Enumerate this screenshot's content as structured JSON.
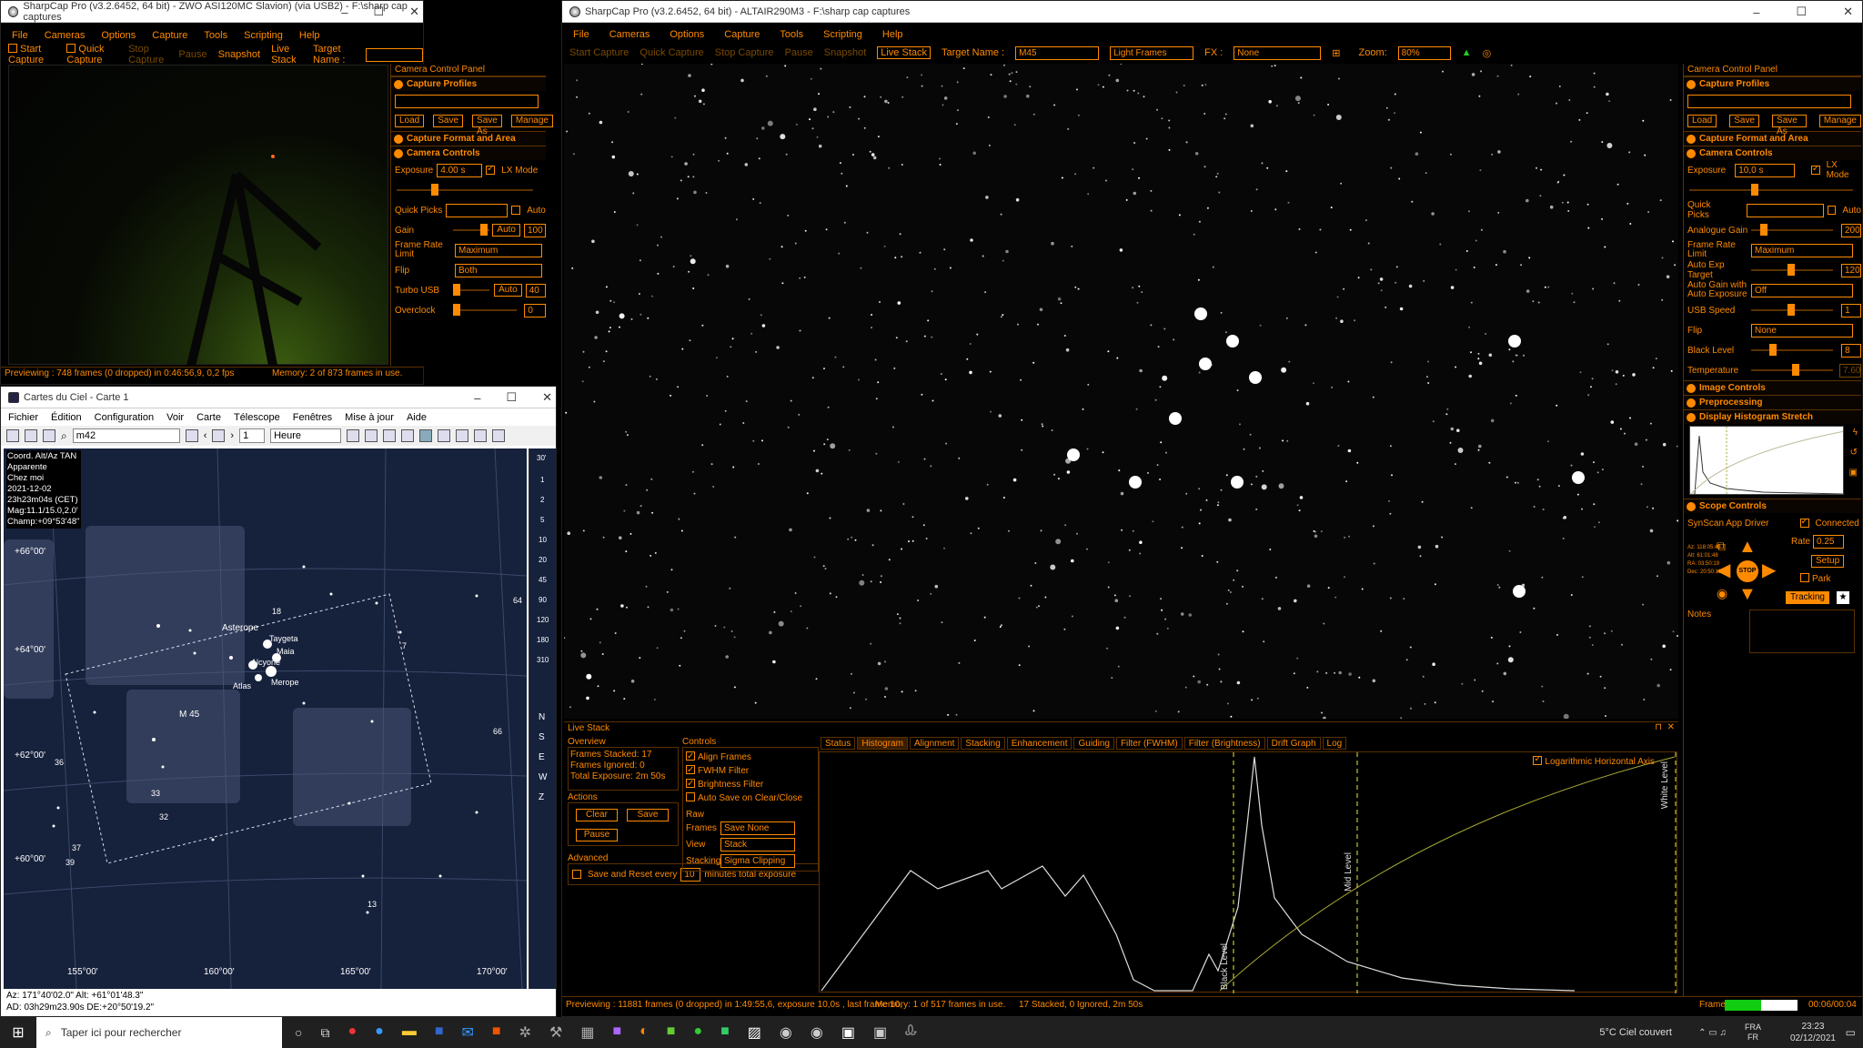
{
  "sc_small": {
    "title": "SharpCap Pro (v3.2.6452, 64 bit) - ZWO ASI120MC Slavion) (via USB2) - F:\\sharp cap captures",
    "menu": [
      "File",
      "Cameras",
      "Options",
      "Capture",
      "Tools",
      "Scripting",
      "Help"
    ],
    "toolbar": {
      "start": "Start Capture",
      "quick": "Quick Capture",
      "stop": "Stop Capture",
      "pause": "Pause",
      "snapshot": "Snapshot",
      "live": "Live Stack",
      "target_label": "Target Name :"
    },
    "panel_title": "Camera Control Panel",
    "profiles": "Capture Profiles",
    "profile_btns": [
      "Load",
      "Save",
      "Save As",
      "Manage"
    ],
    "format": "Capture Format and Area",
    "controls": "Camera Controls",
    "exposure_label": "Exposure",
    "exposure_value": "4.00 s",
    "lx_mode": "LX Mode",
    "quick_picks": "Quick Picks",
    "auto": "Auto",
    "gain_label": "Gain",
    "gain_value": "100",
    "framerate_label": "Frame Rate Limit",
    "framerate_value": "Maximum",
    "flip_label": "Flip",
    "flip_value": "Both",
    "turbo_label": "Turbo USB",
    "turbo_value": "40",
    "overclock_label": "Overclock",
    "overclock_value": "0",
    "status_left": "Previewing : 748 frames (0 dropped) in 0:46:56,9, 0,2 fps",
    "status_mid": "Memory: 2 of 873 frames in use."
  },
  "sc_main": {
    "title": "SharpCap Pro (v3.2.6452, 64 bit) - ALTAIR290M3 - F:\\sharp cap captures",
    "menu": [
      "File",
      "Cameras",
      "Options",
      "Capture",
      "Tools",
      "Scripting",
      "Help"
    ],
    "toolbar": {
      "start": "Start Capture",
      "quick": "Quick Capture",
      "stop": "Stop Capture",
      "pause": "Pause",
      "snapshot": "Snapshot",
      "live": "Live Stack",
      "target_label": "Target Name :",
      "target_value": "M45",
      "frames_value": "Light Frames",
      "fx_label": "FX :",
      "fx_value": "None",
      "zoom_label": "Zoom:",
      "zoom_value": "80%"
    },
    "panel": {
      "title": "Camera Control Panel",
      "profiles": "Capture Profiles",
      "profile_btns": [
        "Load",
        "Save",
        "Save As",
        "Manage"
      ],
      "format": "Capture Format and Area",
      "controls": "Camera Controls",
      "exposure_label": "Exposure",
      "exposure_value": "10,0 s",
      "lx_mode": "LX Mode",
      "quick_picks": "Quick Picks",
      "auto": "Auto",
      "analogue_gain_label": "Analogue Gain",
      "analogue_gain_value": "200",
      "framerate_label": "Frame Rate Limit",
      "framerate_value": "Maximum",
      "autoexp_label": "Auto Exp Target",
      "autoexp_value": "120",
      "autogain_label": "Auto Gain with Auto Exposure",
      "autogain_value": "Off",
      "usb_label": "USB Speed",
      "usb_value": "1",
      "flip_label": "Flip",
      "flip_value": "None",
      "black_label": "Black Level",
      "black_value": "8",
      "temp_label": "Temperature",
      "temp_value": "7.60",
      "image_controls": "Image Controls",
      "preprocessing": "Preprocessing",
      "histo_stretch": "Display Histogram Stretch",
      "scope_controls": "Scope Controls",
      "scope_driver": "SynScan App Driver",
      "connected": "Connected",
      "rate_label": "Rate",
      "rate_value": "0.25",
      "setup": "Setup",
      "park": "Park",
      "tracking": "Tracking",
      "stop": "STOP",
      "scope_readout": [
        "Az: 118:05:49",
        "Alt: 61:01:48",
        "RA: 03:50:19",
        "Dec: 20:50:19"
      ],
      "notes": "Notes"
    },
    "livestack": {
      "title": "Live Stack",
      "overview": "Overview",
      "frames_stacked": "Frames Stacked: 17",
      "frames_ignored": "Frames Ignored: 0",
      "total_exposure": "Total Exposure: 2m 50s",
      "actions": "Actions",
      "clear": "Clear",
      "save": "Save",
      "pause": "Pause",
      "advanced": "Advanced",
      "save_reset_pre": "Save and Reset every",
      "save_reset_val": "10",
      "save_reset_post": "minutes total exposure",
      "controls": "Controls",
      "align": "Align Frames",
      "fwhm": "FWHM Filter",
      "brightness": "Brightness Filter",
      "autosave": "Auto Save on Clear/Close",
      "raw_label": "Raw Frames",
      "raw_value": "Save None",
      "view_label": "View",
      "view_value": "Stack",
      "stacking_label": "Stacking",
      "stacking_value": "Sigma Clipping",
      "tabs": [
        "Status",
        "Histogram",
        "Alignment",
        "Stacking",
        "Enhancement",
        "Guiding",
        "Filter (FWHM)",
        "Filter (Brightness)",
        "Drift Graph",
        "Log"
      ],
      "log_axis": "Logarithmic Horizontal Axis",
      "black_level": "Black Level",
      "mid_level": "Mid Level",
      "white_level": "White Level"
    },
    "status_left": "Previewing : 11881 frames (0 dropped) in 1:49:55,6, exposure 10,0s , last frame 10,",
    "status_mem": "Memory: 1 of 517 frames in use.",
    "status_stack": "17 Stacked, 0 Ignored, 2m 50s",
    "status_frame_label": "Frame:",
    "status_time": "00:06/00:04"
  },
  "cdc": {
    "title": "Cartes du Ciel - Carte 1",
    "menu": [
      "Fichier",
      "Édition",
      "Configuration",
      "Voir",
      "Carte",
      "Télescope",
      "Fenêtres",
      "Mise à jour",
      "Aide"
    ],
    "search_value": "m42",
    "step_value": "1",
    "unit_value": "Heure",
    "info": [
      "Coord. Alt/Az TAN",
      "Apparente",
      "Chez moi",
      "2021-12-02",
      "23h23m04s (CET)",
      "Mag:11.1/15.0,2.0'",
      "Champ:+09°53'48\""
    ],
    "dec_labels": [
      "+66°00'",
      "+64°00'",
      "+62°00'",
      "+60°00'"
    ],
    "ra_labels": [
      "155°00'",
      "160°00'",
      "165°00'",
      "170°00'"
    ],
    "star_names": [
      "Asterope",
      "Taygeta",
      "Maia",
      "Alcyone",
      "Atlas",
      "Merope",
      "M 45"
    ],
    "numbers": [
      "18",
      "64",
      "66",
      "36",
      "33",
      "32",
      "37",
      "39",
      "13",
      "7"
    ],
    "side_scale": [
      "30'",
      "1",
      "2",
      "5",
      "10",
      "20",
      "45",
      "90",
      "120",
      "180",
      "310"
    ],
    "side_letters": [
      "N",
      "S",
      "E",
      "W",
      "Z"
    ],
    "status_az": "Az: 171°40'02.0\" Alt: +61°01'48.3\"",
    "status_ad": "AD: 03h29m23.90s DE:+20°50'19.2\""
  },
  "taskbar": {
    "search_placeholder": "Taper ici pour rechercher",
    "weather": "5°C  Ciel couvert",
    "lang": "FRA",
    "lang2": "FR",
    "time": "23:23",
    "date": "02/12/2021"
  }
}
